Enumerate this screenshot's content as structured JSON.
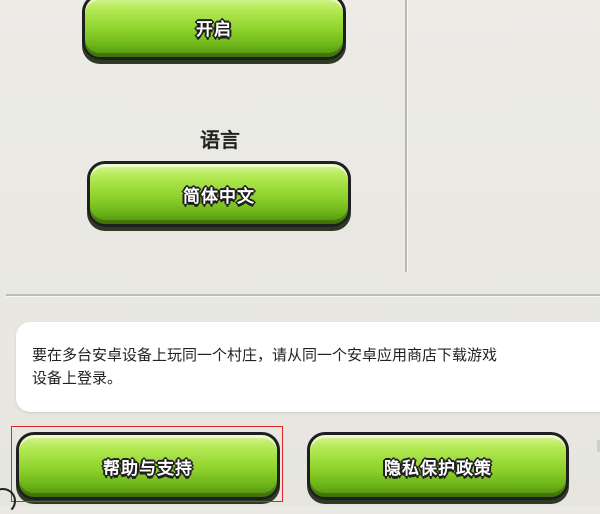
{
  "settings": {
    "enable_button_label": "开启",
    "language_title": "语言",
    "language_button_label": "简体中文"
  },
  "info": {
    "line1": "要在多台安卓设备上玩同一个村庄，请从同一个安卓应用商店下载游戏",
    "line2": "设备上登录。"
  },
  "footer": {
    "help_button_label": "帮助与支持",
    "privacy_button_label": "隐私保护政策"
  },
  "colors": {
    "button_green": "#8ed22c",
    "button_outline": "#1f1f1f",
    "background": "#e9e8e2",
    "highlight_border": "#e2242a"
  }
}
